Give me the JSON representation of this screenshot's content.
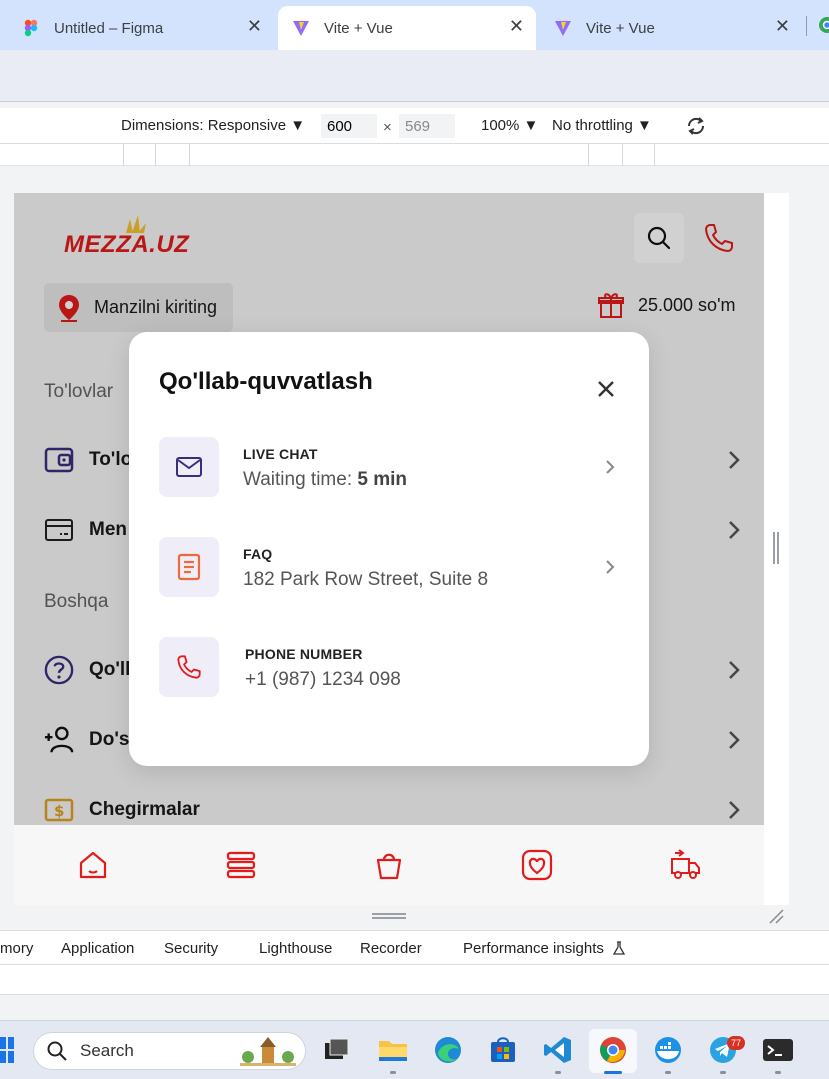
{
  "browser": {
    "tabs": [
      {
        "title": "Untitled – Figma",
        "close": "✕"
      },
      {
        "title": "Vite + Vue",
        "close": "✕"
      },
      {
        "title": "Vite + Vue",
        "close": "✕"
      }
    ]
  },
  "device_toolbar": {
    "dimensions_label": "Dimensions: Responsive",
    "width": "600",
    "times": "×",
    "height": "569",
    "zoom": "100%",
    "throttling": "No throttling"
  },
  "app": {
    "logo": "MEZZA.UZ",
    "address_button": "Manzilni kiriting",
    "bonus": "25.000 so'm",
    "sections": {
      "payments": "To'lovlar",
      "other": "Boshqa"
    },
    "menu": [
      {
        "label": "To'lo",
        "icon": "wallet-icon"
      },
      {
        "label": "Men",
        "icon": "card-icon"
      },
      {
        "label": "Qo'll",
        "icon": "question-icon"
      },
      {
        "label": "Do's",
        "icon": "add-user-icon"
      },
      {
        "label": "Chegirmalar",
        "icon": "discount-icon"
      }
    ],
    "bottom_nav": [
      "home-icon",
      "menu-icon",
      "bag-icon",
      "heart-icon",
      "delivery-icon"
    ]
  },
  "modal": {
    "title": "Qo'llab-quvvatlash",
    "items": [
      {
        "label": "LIVE CHAT",
        "value_prefix": "Waiting time: ",
        "value_bold": "5 min",
        "icon": "mail-icon"
      },
      {
        "label": "FAQ",
        "value": "182 Park Row Street, Suite 8",
        "icon": "document-icon"
      },
      {
        "label": "PHONE NUMBER",
        "value": "+1 (987) 1234 098",
        "icon": "phone-icon"
      }
    ]
  },
  "devtools_tabs": [
    "mory",
    "Application",
    "Security",
    "Lighthouse",
    "Recorder",
    "Performance insights"
  ],
  "taskbar": {
    "search_placeholder": "Search",
    "telegram_badge": "77"
  },
  "colors": {
    "accent_red": "#e31b1b",
    "purple": "#3b2e7e",
    "orange": "#ef6a3a"
  }
}
